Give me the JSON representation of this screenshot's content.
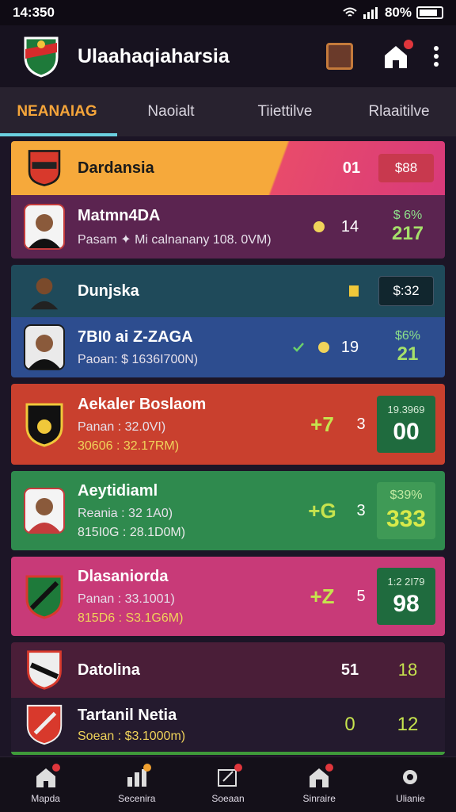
{
  "status": {
    "time": "14:350",
    "battery": "80%"
  },
  "header": {
    "title": "Ulaahaqiaharsia"
  },
  "tabs": [
    {
      "label": "NEANAIAG"
    },
    {
      "label": "Naoialt"
    },
    {
      "label": "Tiiettilve"
    },
    {
      "label": "Rlaaitilve"
    }
  ],
  "cards": [
    {
      "title": "Dardansia",
      "title_stat": "01",
      "title_price": "$88",
      "player_name": "Matmn4DA",
      "player_sub": "Pasam ✦ Mi calnanany 108. 0VM)",
      "player_stat": "14",
      "player_pct_small": "$ 6%",
      "player_pct_big": "217"
    },
    {
      "title": "Dunjska",
      "title_price": "$:32",
      "player_name": "7BI0 ai Z-ZAGA",
      "player_sub": "Paoan: $ 1636I700N)",
      "player_stat": "19",
      "player_pct_small": "$6%",
      "player_pct_big": "21"
    },
    {
      "name": "Aekaler Boslaom",
      "sub": "Panan : 32.0VI)",
      "sub2": "30606 : 32.17RM)",
      "plus": "+7",
      "stat": "3",
      "box_top": "19.3969",
      "box_val": "00"
    },
    {
      "name": "Aeytidiaml",
      "sub": "Reania : 32 1A0)",
      "sub2": "815I0G : 28.1D0M)",
      "plus": "+G",
      "stat": "3",
      "pct_small": "$39%",
      "pct_big": "333"
    },
    {
      "name": "Dlasaniorda",
      "sub": "Panan : 33.1001)",
      "sub2": "815D6 : S3.1G6M)",
      "plus": "+Z",
      "stat": "5",
      "box_top": "1:2 2I79",
      "box_val": "98"
    },
    {
      "title": "Datolina",
      "title_stat": "51",
      "title_val": "18",
      "name": "Tartanil Netia",
      "sub2": "Soean : $3.1000m)",
      "stat": "0",
      "val": "12"
    }
  ],
  "bottom_nav": [
    {
      "label": "Mapda"
    },
    {
      "label": "Secenira"
    },
    {
      "label": "Soeaan"
    },
    {
      "label": "Sinraire"
    },
    {
      "label": "Ulianie"
    }
  ]
}
